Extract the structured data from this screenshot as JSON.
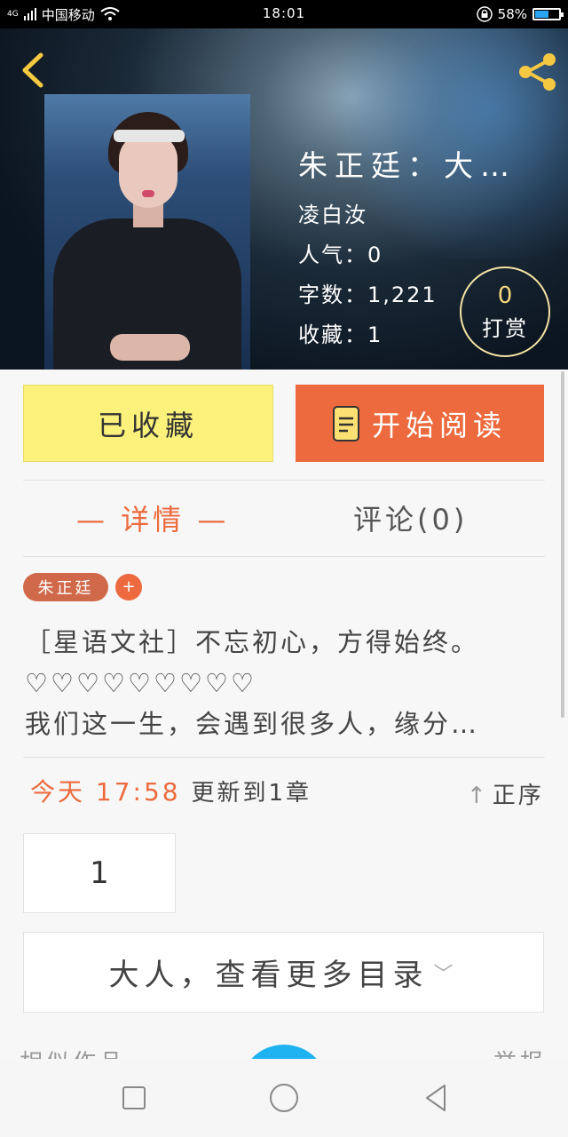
{
  "status_bar": {
    "signal_label": "4G",
    "carrier": "中国移动",
    "time": "18:01",
    "battery": "58%",
    "battery_level": 0.58,
    "icons": [
      "signal-icon",
      "wifi-icon",
      "lock-icon",
      "battery-icon"
    ]
  },
  "header": {
    "back_icon": "back-arrow-icon",
    "share_icon": "share-icon",
    "accent_color": "#f5c842"
  },
  "book": {
    "title": "朱正廷：大…",
    "author": "凌白汝",
    "popularity": "人气：0",
    "word_count": "字数：1,221",
    "favorites": "收藏：1",
    "tip_count": "0",
    "tip_label": "打赏"
  },
  "actions": {
    "favorite_label": "已收藏",
    "read_label": "开始阅读",
    "read_icon": "book-icon"
  },
  "tabs": {
    "detail": "— 详情 —",
    "comments": "评论(0)"
  },
  "tags": {
    "items": [
      "朱正廷"
    ],
    "add_label": "+"
  },
  "description": {
    "lines": [
      "［星语文社］不忘初心，方得始终。",
      "♡♡♡♡♡♡♡♡♡",
      "我们这一生，会遇到很多人，缘分…"
    ]
  },
  "update": {
    "today": "今天 17:58",
    "rest": "更新到1章",
    "sort_label": "正序"
  },
  "chapters": {
    "first": "1",
    "more_label": "大人，查看更多目录"
  },
  "peek": {
    "left": "相似作品",
    "right": "举报"
  },
  "colors": {
    "primary": "#ec6a3e",
    "favorite_bg": "#fbf17b",
    "fab": "#1fb2f1"
  }
}
